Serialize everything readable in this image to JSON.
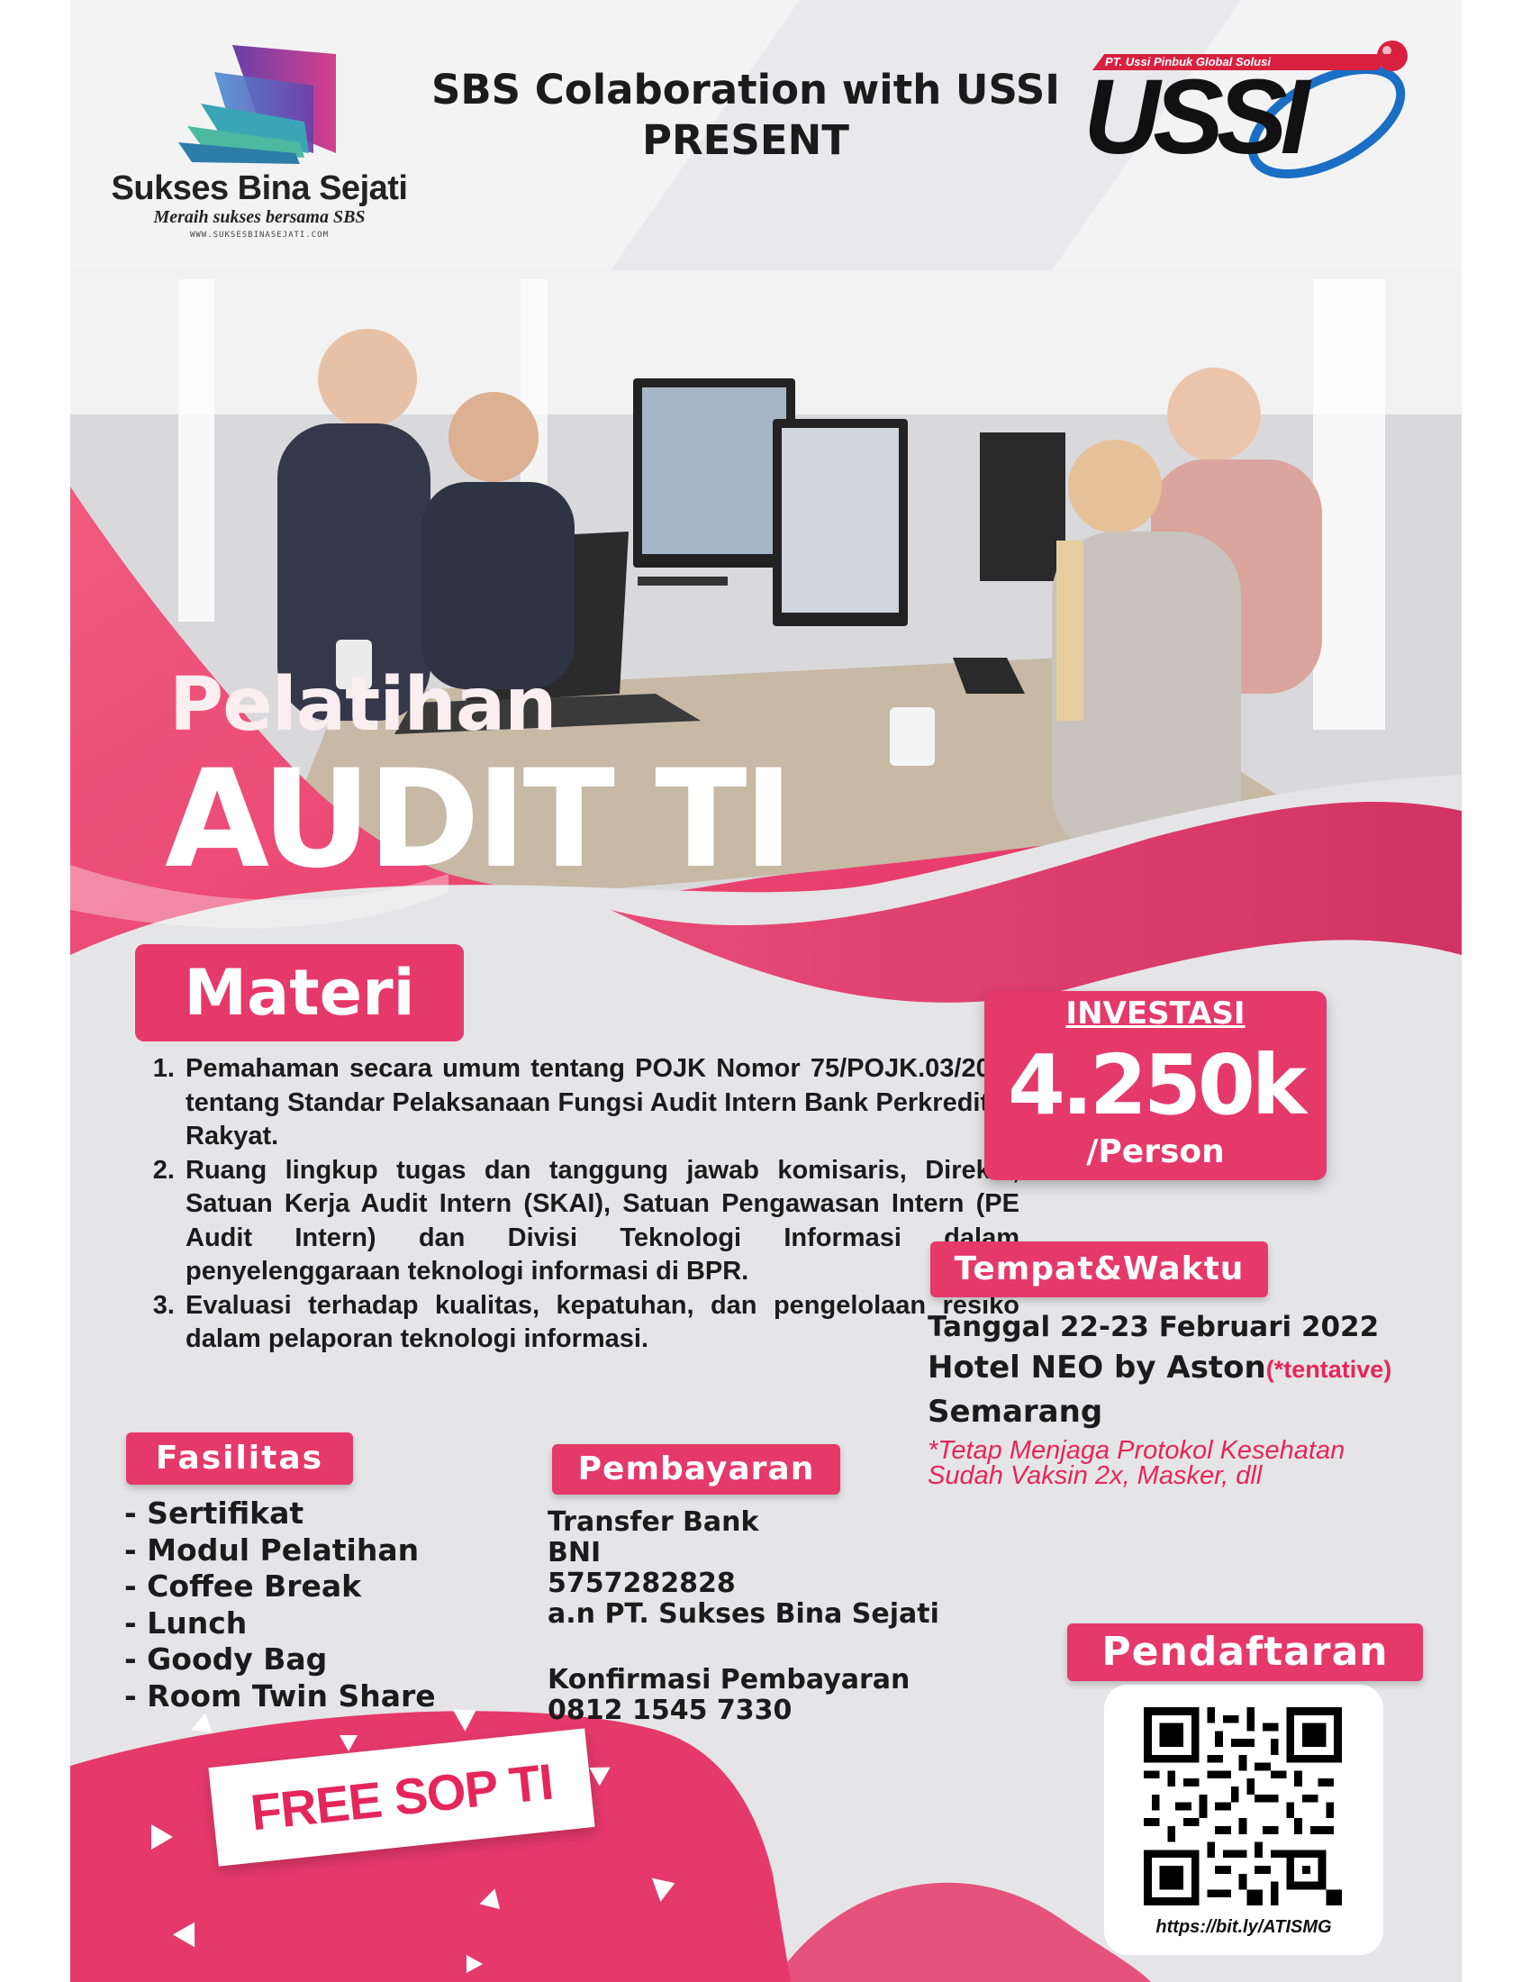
{
  "header": {
    "sbs_name": "Sukses Bina Sejati",
    "sbs_tagline": "Meraih sukses bersama SBS",
    "sbs_url": "WWW.SUKSESBINASEJATI.COM",
    "title_line1": "SBS Colaboration with USSI",
    "title_line2": "PRESENT",
    "ussi_tagline": "PT. Ussi Pinbuk Global Solusi",
    "ussi_logo_text": "USSI"
  },
  "hero": {
    "subtitle": "Pelatihan",
    "title": "AUDIT TI"
  },
  "materi": {
    "heading": "Materi",
    "items": [
      "Pemahaman secara umum tentang POJK Nomor 75/POJK.03/2016 tentang Standar Pelaksanaan Fungsi Audit Intern Bank Perkreditan Rakyat.",
      "Ruang lingkup tugas dan tanggung jawab komisaris, Direksi, Satuan Kerja Audit Intern (SKAI), Satuan Pengawasan Intern (PE Audit Intern) dan Divisi Teknologi Informasi dalam penyelenggaraan teknologi informasi di BPR.",
      "Evaluasi terhadap kualitas, kepatuhan, dan pengelolaan resiko dalam pelaporan teknologi informasi."
    ]
  },
  "investasi": {
    "label": "INVESTASI",
    "value": "4.250k",
    "unit": "/Person"
  },
  "tempat_waktu": {
    "heading": "Tempat&Waktu",
    "date": "Tanggal 22-23 Februari 2022",
    "venue": "Hotel NEO by Aston",
    "tentative": "(*tentative)",
    "city": "Semarang",
    "note_line1": "*Tetap Menjaga Protokol Kesehatan",
    "note_line2": "Sudah Vaksin 2x, Masker, dll"
  },
  "fasilitas": {
    "heading": "Fasilitas",
    "items": [
      "- Sertifikat",
      "- Modul Pelatihan",
      "- Coffee Break",
      "- Lunch",
      "- Goody Bag",
      "- Room Twin Share"
    ]
  },
  "pembayaran": {
    "heading": "Pembayaran",
    "method": "Transfer Bank",
    "bank": "BNI",
    "account": "5757282828",
    "holder": "a.n PT. Sukses Bina Sejati",
    "confirm_label": "Konfirmasi Pembayaran",
    "phone": "0812 1545 7330"
  },
  "pendaftaran": {
    "heading": "Pendaftaran",
    "url": "https://bit.ly/ATISMG"
  },
  "promo": {
    "text": "FREE SOP TI"
  },
  "colors": {
    "accent_pink": "#e5396a",
    "warning_red": "#e5265a",
    "text_dark": "#1b1b1b"
  }
}
